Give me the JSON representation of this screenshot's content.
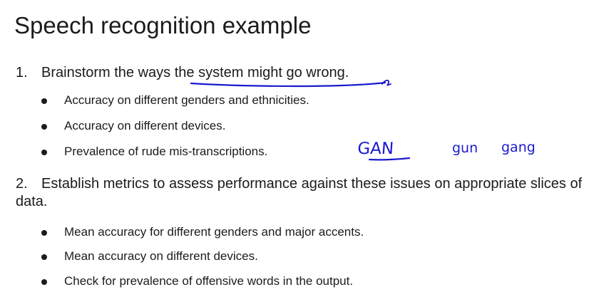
{
  "slide": {
    "title": "Speech recognition example",
    "items": [
      {
        "number": "1.",
        "text": "Brainstorm the ways the system might go wrong.",
        "bullets": [
          "Accuracy on different genders and ethnicities.",
          "Accuracy on different devices.",
          "Prevalence of rude mis-transcriptions."
        ]
      },
      {
        "number": "2.",
        "text": "Establish metrics to assess performance against these issues on appropriate slices of data.",
        "bullets": [
          "Mean accuracy for different genders and major accents.",
          "Mean accuracy on different devices.",
          "Check for prevalence of offensive words in the output."
        ]
      }
    ]
  },
  "annotations": {
    "ink_color": "#1a1ad0",
    "handwritten_words": [
      "GAN",
      "gun",
      "gang"
    ]
  }
}
